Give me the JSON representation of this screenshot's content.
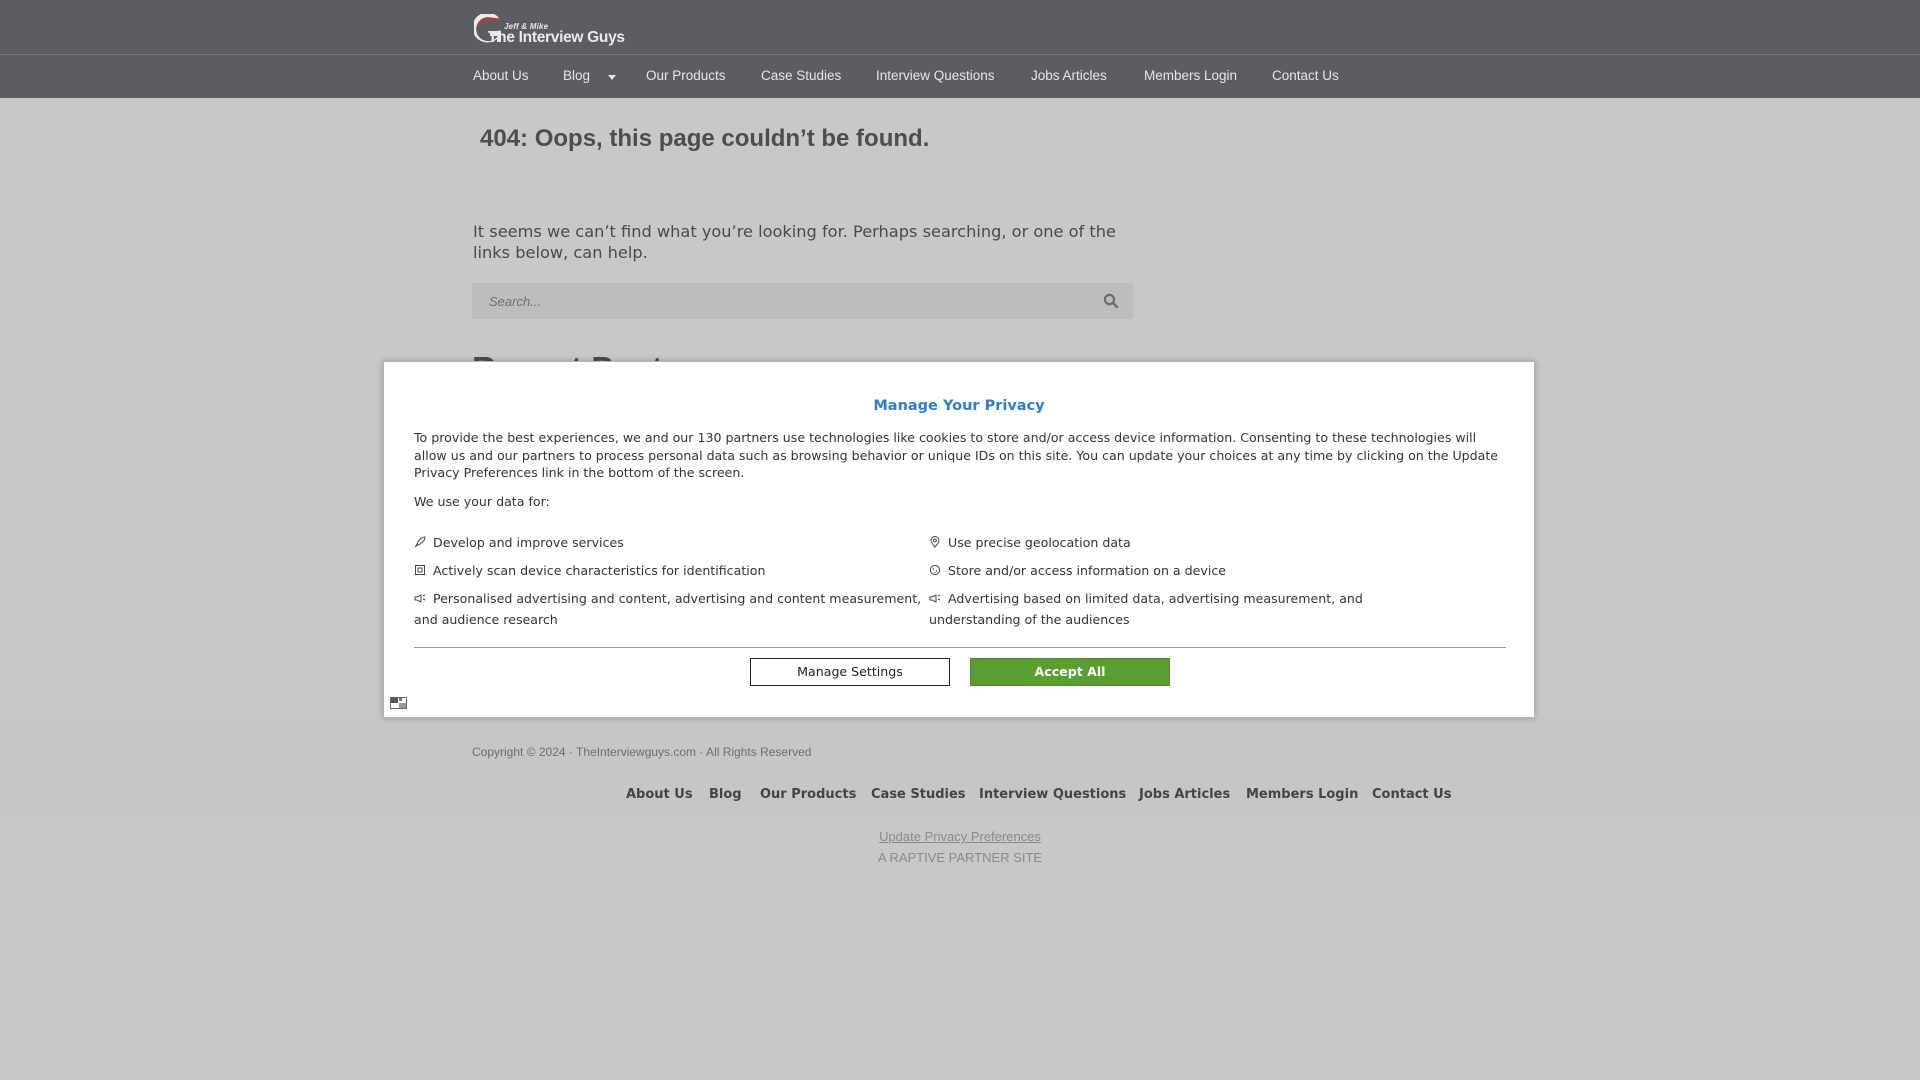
{
  "header": {
    "logo_small": "Jeff & Mike",
    "logo_text": "The Interview Guys"
  },
  "nav": {
    "items": [
      {
        "label": "About Us"
      },
      {
        "label": "Blog"
      },
      {
        "label": "Our Products"
      },
      {
        "label": "Case Studies"
      },
      {
        "label": "Interview Questions"
      },
      {
        "label": "Jobs Articles"
      },
      {
        "label": "Members Login"
      },
      {
        "label": "Contact Us"
      }
    ]
  },
  "main": {
    "title": "404: Oops, this page couldn’t be found.",
    "intro": "It seems we can’t find what you’re looking for. Perhaps searching, or one of the links below, can help.",
    "search_placeholder": "Search...",
    "recent_posts_heading": "Recent Posts"
  },
  "modal": {
    "title": "Manage Your Privacy",
    "description": "To provide the best experiences, we and our 130 partners use technologies like cookies to store and/or access device information. Consenting to these technologies will allow us and our partners to process personal data such as browsing behavior or unique IDs on this site. You can update your choices at any time by clicking on the Update Privacy Preferences link in the bottom of the screen.",
    "subheading": "We use your data for:",
    "purposes": [
      {
        "icon": "rocket-icon",
        "label": "Develop and improve services"
      },
      {
        "icon": "location-pin-icon",
        "label": "Use precise geolocation data"
      },
      {
        "icon": "device-scan-icon",
        "label": "Actively scan device characteristics for identification"
      },
      {
        "icon": "cookie-icon",
        "label": "Store and/or access information on a device"
      },
      {
        "icon": "megaphone-icon",
        "label": "Personalised advertising and content, advertising and content measurement, and audience research"
      },
      {
        "icon": "megaphone-icon",
        "label": "Advertising based on limited data, advertising measurement, and understanding of the audiences"
      }
    ],
    "manage_label": "Manage Settings",
    "accept_label": "Accept All"
  },
  "footer": {
    "copyright": "Copyright © 2024 · TheInterviewguys.com · All Rights Reserved",
    "links": [
      {
        "label": "About Us"
      },
      {
        "label": "Blog"
      },
      {
        "label": "Our Products"
      },
      {
        "label": "Case Studies"
      },
      {
        "label": "Interview Questions"
      },
      {
        "label": "Jobs Articles"
      },
      {
        "label": "Members Login"
      },
      {
        "label": "Contact Us"
      }
    ],
    "privacy_link": "Update Privacy Preferences",
    "partner_text": "A RAPTIVE PARTNER SITE"
  },
  "colors": {
    "header_bg": "#5c5c63",
    "page_bg": "#c8c8c8",
    "modal_title": "#2a7dd4",
    "accept_button": "#5a9e2f"
  }
}
